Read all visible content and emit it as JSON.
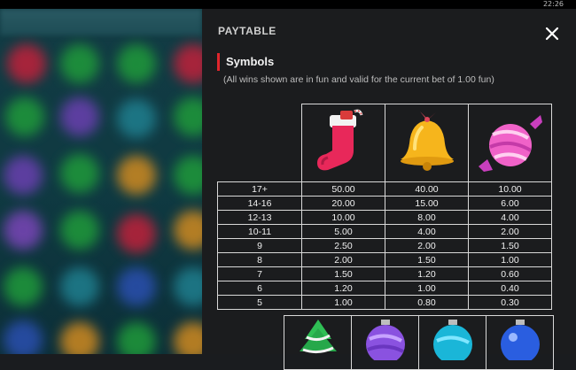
{
  "status": {
    "clock": "22:26"
  },
  "panel": {
    "title": "PAYTABLE",
    "section_title": "Symbols",
    "note": "(All wins shown are in fun and valid for the current bet of 1.00 fun)"
  },
  "symbols": [
    "stocking-icon",
    "bell-icon",
    "candy-icon"
  ],
  "rows": [
    {
      "count": "17+",
      "values": [
        "50.00",
        "40.00",
        "10.00"
      ]
    },
    {
      "count": "14-16",
      "values": [
        "20.00",
        "15.00",
        "6.00"
      ]
    },
    {
      "count": "12-13",
      "values": [
        "10.00",
        "8.00",
        "4.00"
      ]
    },
    {
      "count": "10-11",
      "values": [
        "5.00",
        "4.00",
        "2.00"
      ]
    },
    {
      "count": "9",
      "values": [
        "2.50",
        "2.00",
        "1.50"
      ]
    },
    {
      "count": "8",
      "values": [
        "2.00",
        "1.50",
        "1.00"
      ]
    },
    {
      "count": "7",
      "values": [
        "1.50",
        "1.20",
        "0.60"
      ]
    },
    {
      "count": "6",
      "values": [
        "1.20",
        "1.00",
        "0.40"
      ]
    },
    {
      "count": "5",
      "values": [
        "1.00",
        "0.80",
        "0.30"
      ]
    }
  ],
  "second_symbols": [
    "tree-icon",
    "purple-ornament-icon",
    "cyan-ornament-icon",
    "blue-ornament-icon"
  ],
  "colors": {
    "accent": "#e0262c",
    "panel_bg": "#1b1c1e",
    "game_bg": "#0f3a42"
  }
}
